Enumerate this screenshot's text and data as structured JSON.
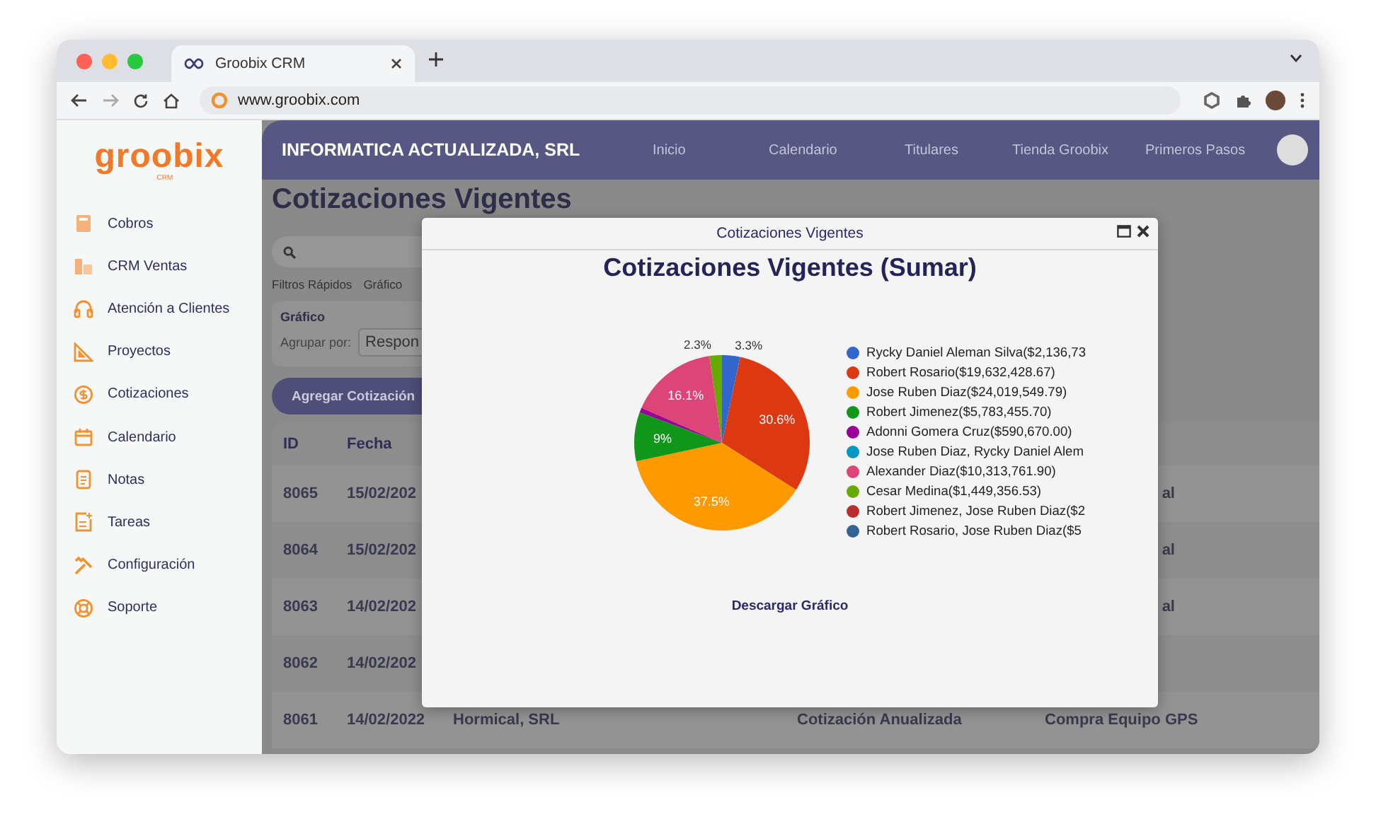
{
  "browser": {
    "tab_title": "Groobix CRM",
    "url": "www.groobix.com"
  },
  "sidebar": {
    "logo": "groobix",
    "logo_sub": "CRM",
    "items": [
      {
        "label": "Cobros",
        "kind": "calculator"
      },
      {
        "label": "CRM Ventas",
        "kind": "coins"
      },
      {
        "label": "Atención a Clientes",
        "kind": "headset"
      },
      {
        "label": "Proyectos",
        "kind": "ruler"
      },
      {
        "label": "Cotizaciones",
        "kind": "dollar"
      },
      {
        "label": "Calendario",
        "kind": "calendar"
      },
      {
        "label": "Notas",
        "kind": "note"
      },
      {
        "label": "Tareas",
        "kind": "task"
      },
      {
        "label": "Configuración",
        "kind": "tools"
      },
      {
        "label": "Soporte",
        "kind": "lifebuoy"
      }
    ]
  },
  "header": {
    "company": "INFORMATICA ACTUALIZADA, SRL",
    "nav": [
      "Inicio",
      "Calendario",
      "Titulares",
      "Tienda Groobix",
      "Primeros Pasos"
    ]
  },
  "page": {
    "title": "Cotizaciones Vigentes",
    "tabs": [
      "Filtros Rápidos",
      "Gráfico"
    ],
    "chart_panel": {
      "title": "Gráfico",
      "group_label": "Agrupar por:",
      "group_value": "Respon"
    },
    "add_button": "Agregar Cotización",
    "table": {
      "columns": [
        "ID",
        "Fecha"
      ],
      "rows": [
        {
          "id": "8065",
          "date": "15/02/202",
          "tail": "al"
        },
        {
          "id": "8064",
          "date": "15/02/202",
          "tail": "al"
        },
        {
          "id": "8063",
          "date": "14/02/202",
          "tail": "al"
        },
        {
          "id": "8062",
          "date": "14/02/202"
        },
        {
          "id": "8061",
          "date": "14/02/2022",
          "client": "Hormical, SRL",
          "status": "Cotización Anualizada",
          "description": "Compra Equipo GPS"
        }
      ]
    }
  },
  "dialog": {
    "title": "Cotizaciones Vigentes",
    "download_link": "Descargar Gráfico",
    "chart_data": {
      "type": "pie",
      "title": "Cotizaciones Vigentes (Sumar)",
      "categories": [
        "Rycky Daniel Aleman Silva($2,136,73",
        "Robert Rosario($19,632,428.67)",
        "Jose Ruben Diaz($24,019,549.79)",
        "Robert Jimenez($5,783,455.70)",
        "Adonni Gomera Cruz($590,670.00)",
        "Jose Ruben Diaz, Rycky Daniel Alem",
        "Alexander Diaz($10,313,761.90)",
        "Cesar Medina($1,449,356.53)",
        "Robert Jimenez, Jose Ruben Diaz($2",
        "Robert Rosario, Jose Ruben Diaz($5"
      ],
      "values": [
        3.3,
        30.6,
        37.5,
        9,
        0.9,
        null,
        16.1,
        2.3,
        null,
        null
      ],
      "legend": "right",
      "colors": [
        "#3366cc",
        "#dc3912",
        "#ff9900",
        "#109618",
        "#990099",
        "#0099c6",
        "#dd4477",
        "#66aa00",
        "#b82e2e",
        "#316395"
      ],
      "value_labels": [
        "3.3%",
        "30.6%",
        "37.5%",
        "9%",
        null,
        null,
        "16.1%",
        "2.3%",
        null,
        null
      ]
    }
  }
}
